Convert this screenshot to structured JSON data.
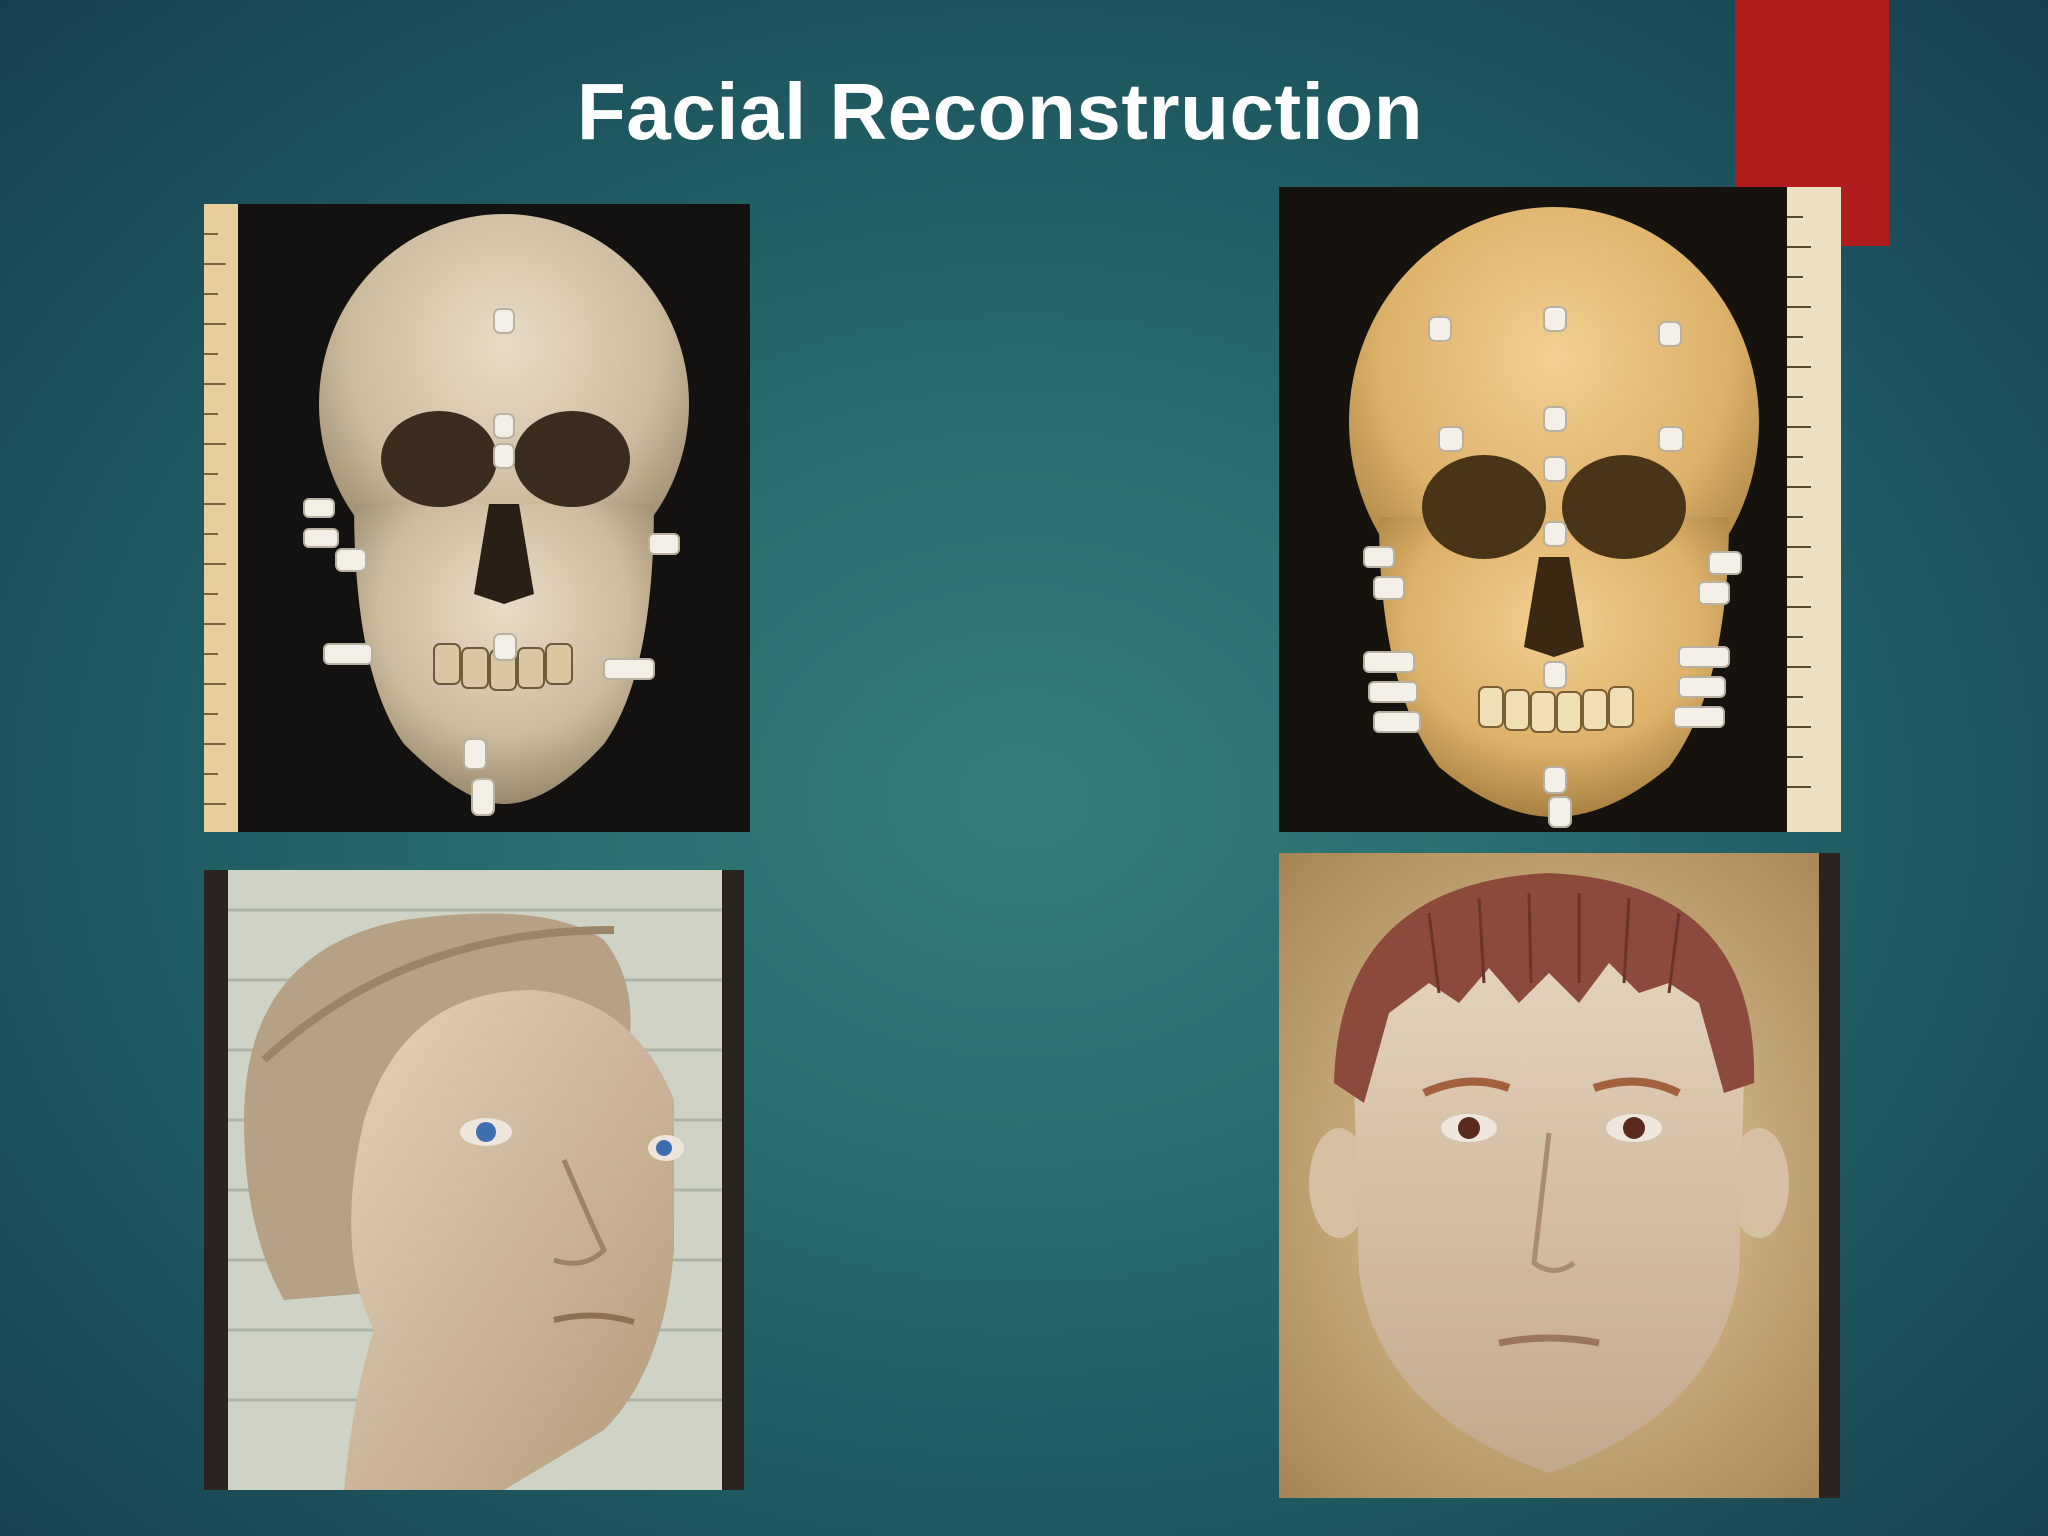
{
  "slide": {
    "title": "Facial Reconstruction"
  },
  "colors": {
    "background": "#2b6f70",
    "accent": "#b01c1c",
    "title": "#ffffff"
  }
}
